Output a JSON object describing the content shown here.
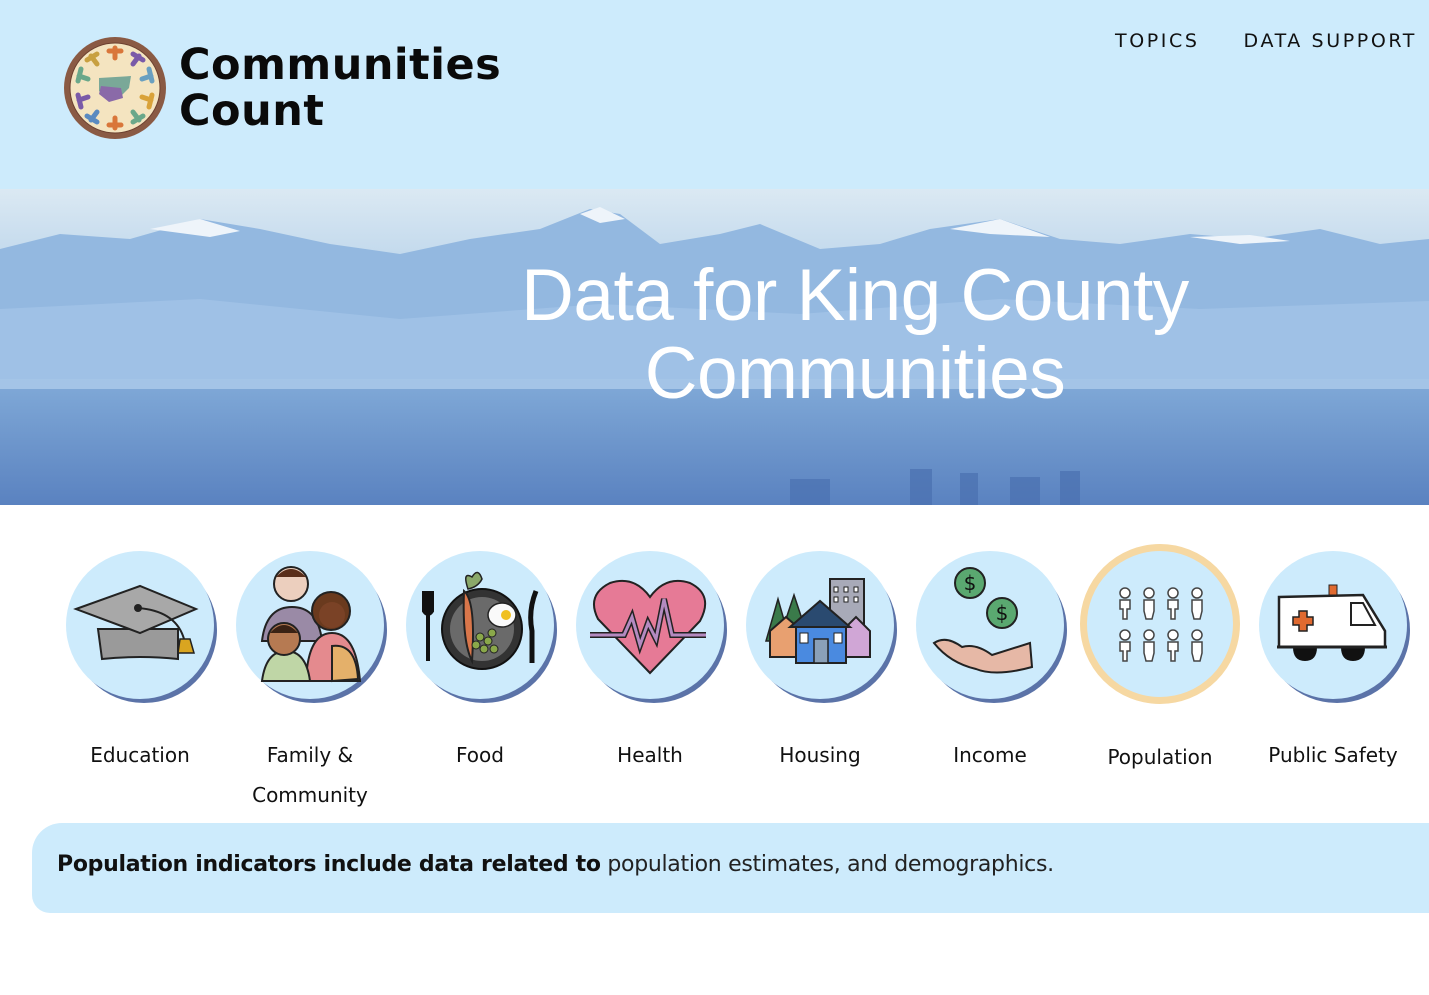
{
  "header": {
    "logo_line1": "Communities",
    "logo_line2": "Count",
    "logo_icon": "communities-count-seal",
    "nav": [
      {
        "label": "TOPICS"
      },
      {
        "label": "DATA SUPPORT"
      }
    ]
  },
  "hero": {
    "title_line1": "Data for King County",
    "title_line2": "Communities",
    "background": "mountain-landscape-image"
  },
  "topics": [
    {
      "label": "Education",
      "icon": "graduation-cap-icon",
      "selected": false
    },
    {
      "label_line1": "Family &",
      "label_line2": "Community",
      "icon": "family-icon",
      "selected": false
    },
    {
      "label": "Food",
      "icon": "food-plate-icon",
      "selected": false
    },
    {
      "label": "Health",
      "icon": "heart-pulse-icon",
      "selected": false
    },
    {
      "label": "Housing",
      "icon": "houses-icon",
      "selected": false
    },
    {
      "label": "Income",
      "icon": "hand-money-icon",
      "selected": false
    },
    {
      "label": "Population",
      "icon": "people-group-icon",
      "selected": true
    },
    {
      "label": "Public Safety",
      "icon": "ambulance-icon",
      "selected": false
    }
  ],
  "info": {
    "bold_text": "Population indicators include data related to",
    "text": " population estimates, and demographics."
  },
  "colors": {
    "header_bg": "#cdebfc",
    "circle_bg": "#cdebfc",
    "circle_shadow": "#5b73a8",
    "selected_ring": "#f6d8a2"
  }
}
